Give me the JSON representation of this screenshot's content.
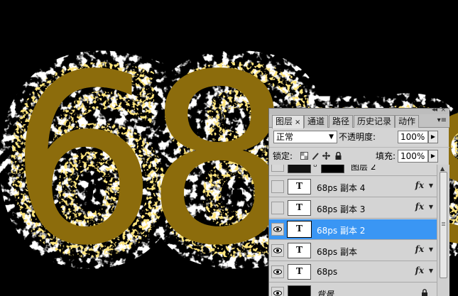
{
  "canvas": {
    "artwork_text": "68ps",
    "text_color": "#8c6c0c",
    "background_color": "#000000"
  },
  "layers_panel": {
    "tabs": [
      {
        "label": "图层",
        "active": true,
        "close": "×"
      },
      {
        "label": "通道"
      },
      {
        "label": "路径"
      },
      {
        "label": "历史记录"
      },
      {
        "label": "动作"
      }
    ],
    "panel_menu_icon": "▾≡",
    "collapse_icon": "◂◂",
    "close_icon": "×",
    "blend_mode": "正常",
    "opacity_label": "不透明度:",
    "opacity_value": "100%",
    "lock_label": "锁定:",
    "fill_label": "填充:",
    "fill_value": "100%",
    "layers": [
      {
        "name": "图层 2",
        "thumb": "",
        "visible": false,
        "fx": false
      },
      {
        "name": "68ps  副本 4",
        "thumb": "T",
        "visible": false,
        "fx": true
      },
      {
        "name": "68ps  副本 3",
        "thumb": "T",
        "visible": false,
        "fx": true
      },
      {
        "name": "68ps  副本 2",
        "thumb": "T",
        "visible": true,
        "fx": true,
        "selected": true
      },
      {
        "name": "68ps  副本",
        "thumb": "T",
        "visible": true,
        "fx": true
      },
      {
        "name": "68ps",
        "thumb": "T",
        "visible": true,
        "fx": true
      },
      {
        "name": "背景",
        "thumb": "",
        "visible": true,
        "fx": false
      }
    ],
    "fx_label": "fx"
  }
}
